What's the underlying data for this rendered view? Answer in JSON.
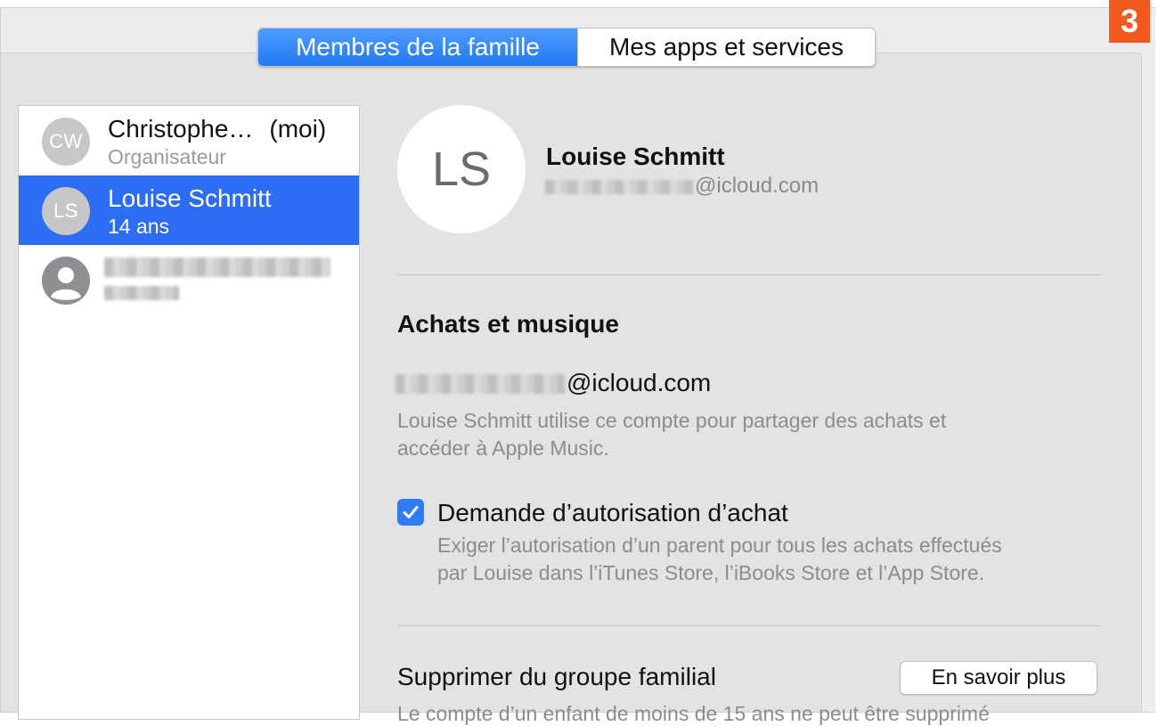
{
  "badge": "3",
  "tabs": {
    "family": "Membres de la famille",
    "apps": "Mes apps et services"
  },
  "members": [
    {
      "initials": "CW",
      "name": "Christophe…",
      "suffix": "(moi)",
      "sub": "Organisateur"
    },
    {
      "initials": "LS",
      "name": "Louise Schmitt",
      "sub": "14 ans"
    }
  ],
  "detail": {
    "initials": "LS",
    "name": "Louise Schmitt",
    "email_domain": "@icloud.com"
  },
  "purchases": {
    "title": "Achats et musique",
    "email_domain": "@icloud.com",
    "description_line1": "Louise Schmitt utilise ce compte pour partager des achats et",
    "description_line2": "accéder à Apple Music.",
    "ask_label": "Demande d’autorisation d’achat",
    "ask_checked": true,
    "ask_desc_line1": "Exiger l’autorisation d’un parent pour tous les achats effectués",
    "ask_desc_line2": "par Louise dans l’iTunes Store, l’iBooks Store et l’App Store."
  },
  "remove": {
    "title": "Supprimer du groupe familial",
    "button": "En savoir plus",
    "partial_text": "Le compte d’un enfant de moins de 15 ans ne peut être supprimé"
  },
  "colors": {
    "accent": "#2f7cf6",
    "selection": "#2d6df3",
    "badge": "#f05a1e"
  }
}
